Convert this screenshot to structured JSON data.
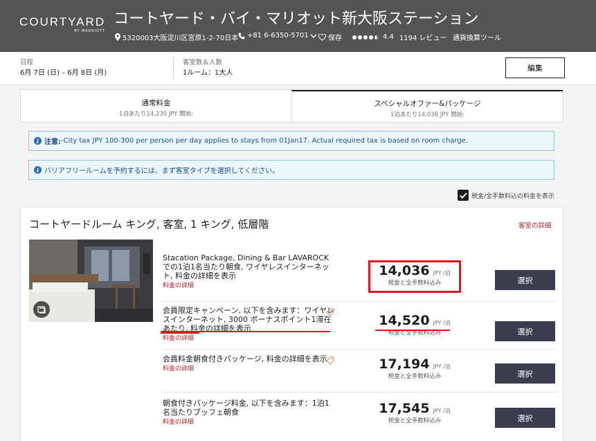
{
  "header": {
    "logo": "COURTYARD",
    "logo_sub": "BY MARRIOTT",
    "hotel_name": "コートヤード・バイ・マリオット新大阪ステーション",
    "address": "5320003大阪淀川区宮原1-2-70日本",
    "phone": "+81 6-6350-5701",
    "save": "保存",
    "rating": "4.4",
    "reviews": "1194 レビュー",
    "currency": "通貨換算ツール"
  },
  "stay": {
    "dates_label": "日程",
    "dates_value": "6月 7日 (日) – 6月 8日 (月)",
    "guests_label": "客室数＆人数",
    "guests_value": "1ルーム：1大人",
    "edit_label": "編集"
  },
  "tabs": [
    {
      "title": "通常料金",
      "sub": "1泊あたり14,230 JPY 開始:"
    },
    {
      "title": "スペシャルオファー&パッケージ",
      "sub": "1泊あたり14,036 JPY 開始:"
    }
  ],
  "notices": {
    "tax_label": "注意:",
    "tax_text": "-City tax JPY 100-300 per person per day applies to stays from 01Jan17. Actual required tax is based on room charge.",
    "barrier_free": "バリアフリールームを予約するには、まず客室タイプを選択してください。"
  },
  "tax_toggle_label": "税金/全手数料込の料金を表示",
  "room": {
    "title": "コートヤードルーム キング, 客室, 1 キング, 低層階",
    "details_link": "客室の詳細",
    "rates": [
      {
        "desc": "Stacation Package, Dining & Bar LAVAROCKでの1泊1名当たり朝食, ワイヤレスインターネット, 料金の詳細を表示",
        "link": "料金の詳細",
        "price": "14,036",
        "unit": "JPY /泊",
        "note": "税金と全手数料込み",
        "select": "選択"
      },
      {
        "desc": "会員限定キャンペーン, 以下を含みます：ワイヤレスインターネット, 3000 ボーナスポイント1滞在あたり, 料金の詳細を表示",
        "link": "料金の詳細",
        "price": "14,520",
        "unit": "JPY /泊",
        "note": "税金と全手数料込み",
        "select": "選択"
      },
      {
        "desc": "会員料金朝食付きパッケージ, 料金の詳細を表示",
        "link": "料金の詳細",
        "price": "17,194",
        "unit": "JPY /泊",
        "note": "税金と全手数料込み",
        "select": "選択"
      },
      {
        "desc": "朝食付きパッケージ料金, 以下を含みます：1泊1名当たりブッフェ朝食",
        "link": "料金の詳細",
        "price": "17,545",
        "unit": "JPY /泊",
        "note": "税金と全手数料込み",
        "select": "選択"
      }
    ]
  }
}
